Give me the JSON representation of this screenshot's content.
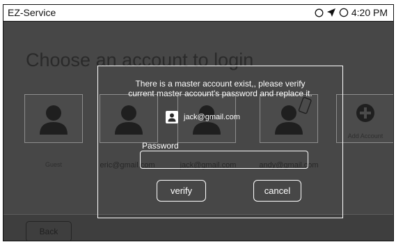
{
  "app": {
    "title": "EZ-Service",
    "status": {
      "time": "4:20 PM"
    }
  },
  "background": {
    "heading": "Choose an account to login",
    "accounts": [
      {
        "label": "Guest"
      },
      {
        "label": "eric@gmail.com"
      },
      {
        "label": "jack@gmail.com"
      },
      {
        "label": "andy@gmail.com"
      },
      {
        "label": "Add Account"
      }
    ],
    "back_label": "Back"
  },
  "dialog": {
    "message_line1": "There is a master account exist,, please verify",
    "message_line2": "current master account's password and replace it.",
    "account_email": "jack@gmail.com",
    "password_label": "Password",
    "password_value": "",
    "verify_label": "verify",
    "cancel_label": "cancel"
  },
  "colors": {
    "overlay": "#474747",
    "dialog_border": "#ffffff",
    "titlebar": "#ffffff"
  }
}
